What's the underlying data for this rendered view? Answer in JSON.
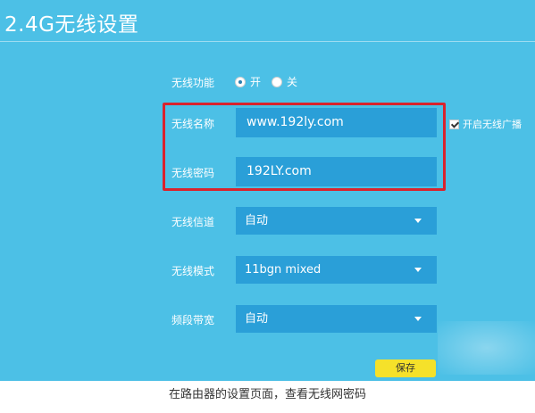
{
  "page_title": "2.4G无线设置",
  "wireless_function": {
    "label": "无线功能",
    "option_on": "开",
    "option_off": "关",
    "selected": "开"
  },
  "ssid": {
    "label": "无线名称",
    "value": "www.192ly.com"
  },
  "password": {
    "label": "无线密码",
    "value": "192LY.com"
  },
  "broadcast": {
    "label": "开启无线广播",
    "checked": true
  },
  "channel": {
    "label": "无线信道",
    "value": "自动"
  },
  "mode": {
    "label": "无线模式",
    "value": "11bgn mixed"
  },
  "bandwidth": {
    "label": "频段带宽",
    "value": "自动"
  },
  "save_label": "保存",
  "caption": "在路由器的设置页面，查看无线网密码",
  "colors": {
    "panel_bg": "#4cc0e6",
    "field_bg": "#2a9fd8",
    "highlight_border": "#d9232d",
    "save_button_bg": "#f5e12a"
  }
}
